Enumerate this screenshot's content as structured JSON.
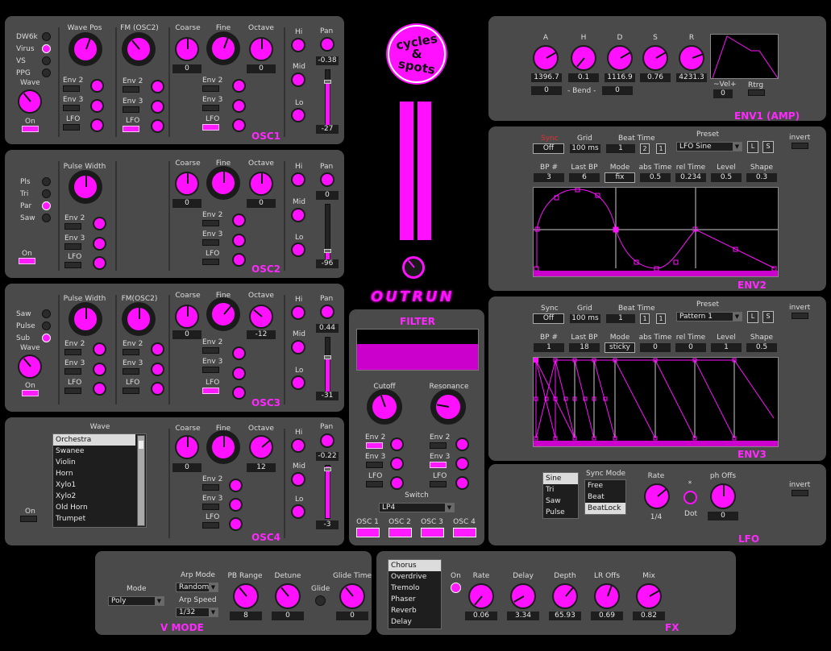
{
  "osc1": {
    "title": "OSC1",
    "modes": [
      "DW6k",
      "Virus",
      "VS",
      "PPG"
    ],
    "mode_on": "Virus",
    "wave_label": "Wave",
    "on_label": "On",
    "wave_pos": "Wave Pos",
    "fm": "FM (OSC2)",
    "coarse": "Coarse",
    "fine": "Fine",
    "octave": "Octave",
    "coarse_val": "0",
    "octave_val": "0",
    "hi": "Hi",
    "mid": "Mid",
    "lo": "Lo",
    "pan": "Pan",
    "pan_val": "-0.38",
    "level_val": "-27",
    "env2": "Env 2",
    "env3": "Env 3",
    "lfo": "LFO"
  },
  "osc2": {
    "title": "OSC2",
    "modes": [
      "Pls",
      "Tri",
      "Par",
      "Saw"
    ],
    "mode_on": "Par",
    "on_label": "On",
    "pulse_width": "Pulse Width",
    "coarse": "Coarse",
    "fine": "Fine",
    "octave": "Octave",
    "coarse_val": "0",
    "octave_val": "0",
    "hi": "Hi",
    "mid": "Mid",
    "lo": "Lo",
    "pan": "Pan",
    "pan_val": "0",
    "level_val": "-96",
    "env2": "Env 2",
    "env3": "Env 3",
    "lfo": "LFO"
  },
  "osc3": {
    "title": "OSC3",
    "modes": [
      "Saw",
      "Pulse",
      "Sub"
    ],
    "mode_on": "Sub",
    "wave_label": "Wave",
    "on_label": "On",
    "pulse_width": "Pulse Width",
    "fm": "FM(OSC2)",
    "coarse": "Coarse",
    "fine": "Fine",
    "octave": "Octave",
    "coarse_val": "0",
    "octave_val": "-12",
    "hi": "Hi",
    "mid": "Mid",
    "lo": "Lo",
    "pan": "Pan",
    "pan_val": "0.44",
    "level_val": "-31",
    "env2": "Env 2",
    "env3": "Env 3",
    "lfo": "LFO"
  },
  "osc4": {
    "title": "OSC4",
    "wave_label": "Wave",
    "on_label": "On",
    "waves": [
      "Orchestra",
      "Swanee",
      "Violin",
      "Horn",
      "Xylo1",
      "Xylo2",
      "Old Horn",
      "Trumpet"
    ],
    "wave_selected": "Orchestra",
    "coarse": "Coarse",
    "fine": "Fine",
    "octave": "Octave",
    "coarse_val": "0",
    "octave_val": "12",
    "hi": "Hi",
    "mid": "Mid",
    "lo": "Lo",
    "pan": "Pan",
    "pan_val": "-0.22",
    "level_val": "-3",
    "env2": "Env 2",
    "env3": "Env 3",
    "lfo": "LFO"
  },
  "logo": {
    "line1": "cycles",
    "amp": "&",
    "line2": "spots",
    "name": "OUTRUN"
  },
  "filter": {
    "title": "FILTER",
    "cutoff": "Cutoff",
    "resonance": "Resonance",
    "env2": "Env 2",
    "env3": "Env 3",
    "lfo": "LFO",
    "switch": "Switch",
    "switch_val": "LP4",
    "osc_buttons": [
      "OSC 1",
      "OSC 2",
      "OSC 3",
      "OSC 4"
    ]
  },
  "env1": {
    "title": "ENV1 (AMP)",
    "a": "A",
    "h": "H",
    "d": "D",
    "s": "S",
    "r": "R",
    "a_val": "1396.7",
    "h_val": "0.1",
    "d_val": "1116.9",
    "s_val": "0.76",
    "r_val": "4231.3",
    "bend": "- Bend -",
    "bend_l": "0",
    "bend_r": "0",
    "vel": "~Vel+",
    "vel_val": "0",
    "rtrg": "Rtrg"
  },
  "env2": {
    "title": "ENV2",
    "sync": "Sync",
    "sync_val": "Off",
    "grid": "Grid",
    "grid_val": "100 ms",
    "beat_time": "Beat Time",
    "bt1": "1",
    "bt2": "2",
    "bt3": "1",
    "preset": "Preset",
    "preset_val": "LFO Sine",
    "l": "L",
    "s": "S",
    "invert": "invert",
    "bp": "BP #",
    "bp_val": "3",
    "last_bp": "Last BP",
    "last_bp_val": "6",
    "mode": "Mode",
    "mode_val": "fix",
    "abs_time": "abs Time",
    "abs_time_val": "0.5",
    "rel_time": "rel Time",
    "rel_time_val": "0.234",
    "level": "Level",
    "level_val": "0.5",
    "shape": "Shape",
    "shape_val": "0.3"
  },
  "env3": {
    "title": "ENV3",
    "sync": "Sync",
    "sync_val": "Off",
    "grid": "Grid",
    "grid_val": "100 ms",
    "beat_time": "Beat Time",
    "bt1": "1",
    "bt2": "1",
    "bt3": "1",
    "preset": "Preset",
    "preset_val": "Pattern 1",
    "l": "L",
    "s": "S",
    "invert": "invert",
    "bp": "BP #",
    "bp_val": "1",
    "last_bp": "Last BP",
    "last_bp_val": "18",
    "mode": "Mode",
    "mode_val": "sticky",
    "abs_time": "abs Time",
    "abs_time_val": "0",
    "rel_time": "rel Time",
    "rel_time_val": "0",
    "level": "Level",
    "level_val": "1",
    "shape": "Shape",
    "shape_val": "0.5"
  },
  "lfo": {
    "title": "LFO",
    "waves": [
      "Sine",
      "Tri",
      "Saw",
      "Pulse"
    ],
    "wave_selected": "Sine",
    "sync_mode": "Sync Mode",
    "sync_modes": [
      "Free",
      "Beat",
      "BeatLock"
    ],
    "sync_selected": "BeatLock",
    "rate": "Rate",
    "rate_val": "1/4",
    "dot_star": "*",
    "dot": "Dot",
    "ph_offs": "ph Offs",
    "ph_val": "0",
    "invert": "invert"
  },
  "vmode": {
    "title": "V MODE",
    "mode": "Mode",
    "mode_val": "Poly",
    "arp_mode": "Arp Mode",
    "arp_mode_val": "Random",
    "arp_speed": "Arp Speed",
    "arp_speed_val": "1/32",
    "pb_range": "PB Range",
    "pb_val": "8",
    "detune": "Detune",
    "detune_val": "0",
    "glide": "Glide",
    "glide_time": "Glide Time",
    "glide_time_val": "0"
  },
  "fx": {
    "title": "FX",
    "types": [
      "Chorus",
      "Overdrive",
      "Tremolo",
      "Phaser",
      "Reverb",
      "Delay"
    ],
    "type_selected": "Chorus",
    "on": "On",
    "rate": "Rate",
    "rate_val": "0.06",
    "delay": "Delay",
    "delay_val": "3.34",
    "depth": "Depth",
    "depth_val": "65.93",
    "lr_offs": "LR Offs",
    "lr_val": "0.69",
    "mix": "Mix",
    "mix_val": "0.82"
  },
  "colors": {
    "accent": "#ff10ff",
    "panel": "#4a4a4a",
    "background": "#000000"
  }
}
